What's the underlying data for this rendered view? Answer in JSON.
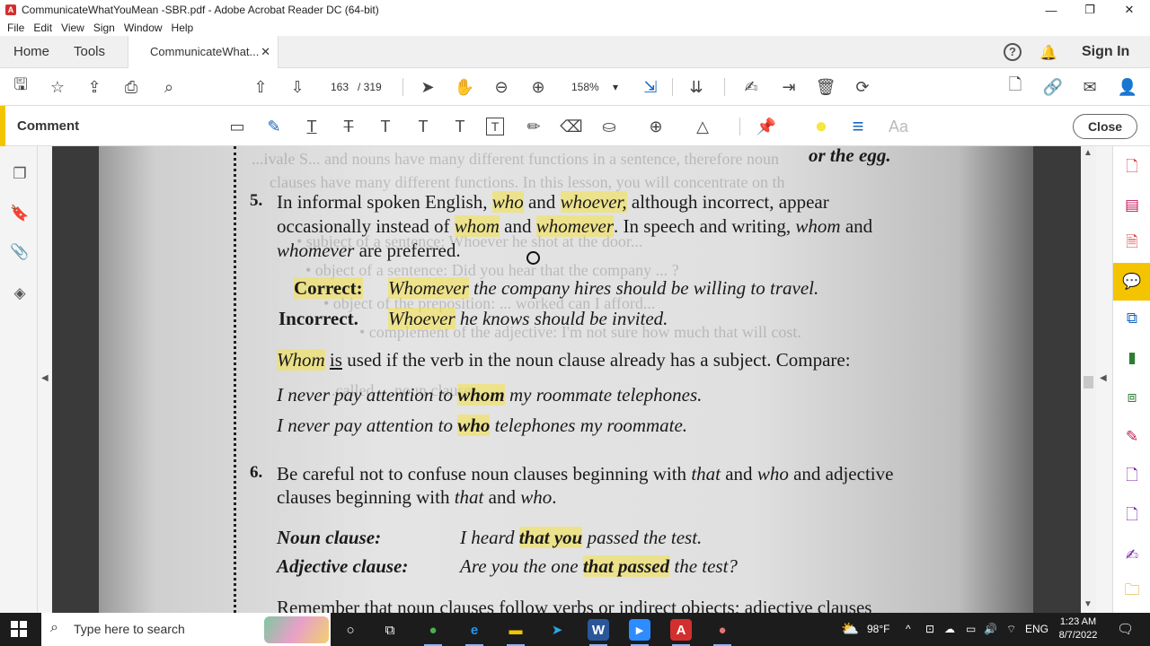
{
  "window": {
    "title": "CommunicateWhatYouMean -SBR.pdf - Adobe Acrobat Reader DC (64-bit)",
    "app_icon_glyph": "A",
    "controls": {
      "minimize": "—",
      "restore": "❐",
      "close": "✕"
    }
  },
  "menu": [
    "File",
    "Edit",
    "View",
    "Sign",
    "Window",
    "Help"
  ],
  "tabs": {
    "home": "Home",
    "tools": "Tools",
    "document": "CommunicateWhat...",
    "close_glyph": "✕",
    "help_glyph": "?",
    "bell_glyph": "🔔",
    "sign_in": "Sign In"
  },
  "toolbar": {
    "icons": {
      "save": "🖫",
      "bookmark_star": "☆",
      "upload": "⇪",
      "print": "⎙",
      "find": "⌕",
      "prev_page": "⇧",
      "next_page": "⇩",
      "select": "➤",
      "hand": "✋",
      "zoom_out": "⊖",
      "zoom_in": "⊕",
      "fit": "⇲",
      "scroll_mode": "⇊",
      "sign_pen": "✍",
      "export": "⇥",
      "delete": "🗑",
      "rotate": "⟳",
      "add_pdf": "🗋",
      "share_link": "🔗",
      "email": "✉",
      "account": "👤"
    },
    "current_page": "163",
    "page_separator": "/ 319",
    "zoom": "158%",
    "zoom_caret": "▾"
  },
  "comment_bar": {
    "label": "Comment",
    "tools": {
      "sticky_note": "▭",
      "highlight": "✎",
      "underline": "T",
      "strikethrough": "T",
      "replace_text": "T",
      "insert_text": "T",
      "add_text": "T",
      "text_box": "T",
      "pencil": "✏",
      "eraser": "⌫",
      "stamp": "⛀",
      "attach": "⊕",
      "shapes": "△",
      "pin": "📌",
      "color": "●",
      "line_weight": "≡",
      "font": "Aa"
    },
    "close": "Close"
  },
  "left_nav": {
    "icons": {
      "pages": "❐",
      "bookmarks": "🔖",
      "attachments": "📎",
      "layers": "◈"
    },
    "collapse_glyph": "◀"
  },
  "document": {
    "ghost_lines": [
      "...ivale S... and nouns have many different functions in a sentence, therefore noun",
      "clauses have many different functions. In this lesson, you will concentrate on th",
      "• subject of a sentence: Whoever he shot at the door...",
      "• object of a sentence: Did you hear that the company ... ?",
      "• object of the preposition: ... worked can I afford...",
      "• complement of the adjective: I'm not sure how much that will cost.",
      "...called ... noun clauses."
    ],
    "top_fragment": "or the egg.",
    "rule5": {
      "number": "5.",
      "line1": {
        "a": "In informal spoken English, ",
        "who": "who",
        "and": " and ",
        "whoever": "whoever,",
        "rest": " although incorrect, appear"
      },
      "line2": {
        "a": "occasionally instead of ",
        "whom": "whom",
        "and": " and ",
        "whomever": "whomever",
        "rest1": ". In speech and writing, ",
        "whom2": "whom",
        "rest2": " and"
      },
      "line3": {
        "whomever": "whomever",
        "rest": " are preferred."
      },
      "correct_label": "Correct:",
      "correct_hl": "Whomever",
      "correct_rest": " the company hires should be willing to travel.",
      "incorrect_label": "Incorrect.",
      "incorrect_hl": "Whoever",
      "incorrect_rest": " he knows should be invited.",
      "compare": {
        "whom": "Whom",
        "is": "is",
        "rest": " used if the verb in the noun clause already has a subject. Compare:"
      },
      "ex1": {
        "a": "I never pay attention to ",
        "hl": "whom",
        "b": " my roommate telephones."
      },
      "ex2": {
        "a": "I never pay attention to ",
        "hl": "who",
        "b": " telephones my roommate."
      }
    },
    "rule6": {
      "number": "6.",
      "line1": {
        "a": "Be careful not to confuse noun clauses beginning with ",
        "that": "that",
        "and": " and ",
        "who": "who",
        "rest": " and adjective"
      },
      "line2": {
        "a": "clauses beginning with ",
        "that": "that",
        "and": " and ",
        "who": "who",
        "dot": "."
      },
      "noun_label": "Noun clause:",
      "noun_ex": {
        "a": "I heard ",
        "hl": "that you",
        "b": " passed the test."
      },
      "adj_label": "Adjective clause:",
      "adj_ex": {
        "a": "Are you the one ",
        "hl": "that passed",
        "b": " the test?"
      },
      "cut_line": "Remember that noun clauses follow verbs or indirect objects; adjective clauses"
    }
  },
  "scrollbar": {
    "up": "▲",
    "down": "▼"
  },
  "right_panel": {
    "collapse_glyph": "◀",
    "icons": {
      "create_pdf": "🗋",
      "organize": "▤",
      "export_pdf": "🗎",
      "comment": "💬",
      "combine": "⧉",
      "edit": "▮",
      "scan": "⧈",
      "fill_sign": "✎",
      "request_sign": "🗋",
      "protect": "🗋",
      "sign": "✍",
      "more": "🗀"
    },
    "colors": {
      "red": "#d83b3b",
      "pink": "#c2185b",
      "green": "#2e7d32",
      "blue": "#1565c0",
      "purple": "#7b1fa2",
      "accent": "#f5c400"
    }
  },
  "taskbar": {
    "search_placeholder": "Type here to search",
    "search_icon": "⌕",
    "apps": {
      "cortana": "○",
      "task_view": "⧉",
      "chrome": "●",
      "edge": "e",
      "explorer": "▬",
      "telegram": "➤",
      "word": "W",
      "zoom": "▶",
      "acrobat": "A",
      "chrome2": "●"
    },
    "weather": "98°F",
    "weather_icon": "⛅",
    "tray_icons": {
      "chevron": "^",
      "meet": "⊡",
      "cloud": "☁",
      "battery": "▭",
      "volume": "🔊",
      "wifi": "⌔"
    },
    "language": "ENG",
    "time": "1:23 AM",
    "date": "8/7/2022",
    "notification": "🗨"
  }
}
